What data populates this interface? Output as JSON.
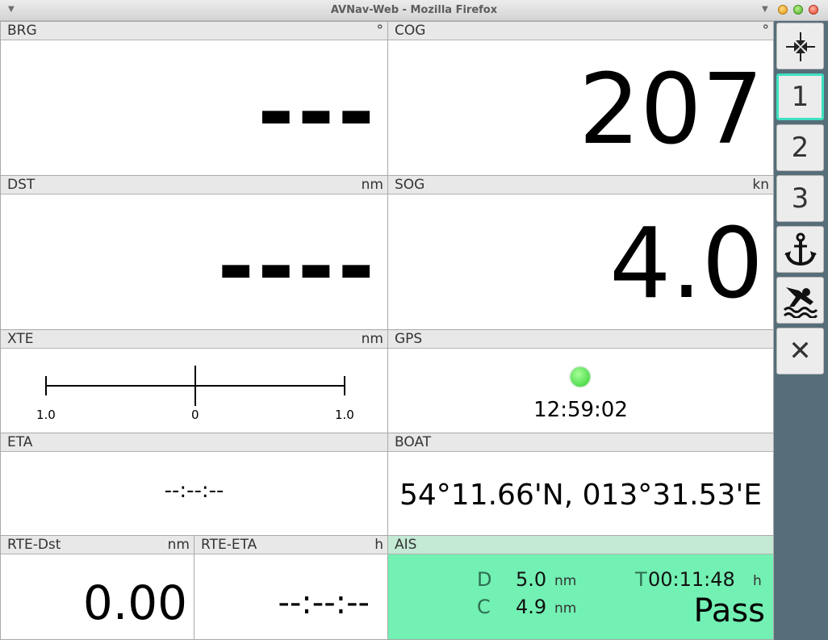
{
  "window": {
    "title": "AVNav-Web - Mozilla Firefox"
  },
  "panels": {
    "brg": {
      "label": "BRG",
      "unit": "°",
      "value": "---"
    },
    "cog": {
      "label": "COG",
      "unit": "°",
      "value": "207"
    },
    "dst": {
      "label": "DST",
      "unit": "nm",
      "value": "----"
    },
    "sog": {
      "label": "SOG",
      "unit": "kn",
      "value": "4.0"
    },
    "xte": {
      "label": "XTE",
      "unit": "nm",
      "left": "1.0",
      "center": "0",
      "right": "1.0"
    },
    "gps": {
      "label": "GPS",
      "time": "12:59:02",
      "status_color": "#44dd44"
    },
    "eta": {
      "label": "ETA",
      "value": "--:--:--"
    },
    "boat": {
      "label": "BOAT",
      "value": "54°11.66'N, 013°31.53'E"
    },
    "rte_dst": {
      "label": "RTE-Dst",
      "unit": "nm",
      "value": "0.00"
    },
    "rte_eta": {
      "label": "RTE-ETA",
      "unit": "h",
      "value": "--:--:--"
    },
    "ais": {
      "label": "AIS",
      "d_label": "D",
      "d_value": "5.0",
      "d_unit": "nm",
      "c_label": "C",
      "c_value": "4.9",
      "c_unit": "nm",
      "t_label": "T",
      "t_value": "00:11:48",
      "t_unit": "h",
      "status": "Pass",
      "bg_color": "#73f0b3"
    }
  },
  "sidebar": {
    "buttons": [
      {
        "name": "collapse",
        "label": ""
      },
      {
        "name": "page-1",
        "label": "1"
      },
      {
        "name": "page-2",
        "label": "2"
      },
      {
        "name": "page-3",
        "label": "3"
      },
      {
        "name": "anchor",
        "label": ""
      },
      {
        "name": "man-overboard",
        "label": ""
      },
      {
        "name": "close",
        "label": "✕"
      }
    ],
    "active_color": "#3fe0c0",
    "bg_color": "#566e79"
  }
}
